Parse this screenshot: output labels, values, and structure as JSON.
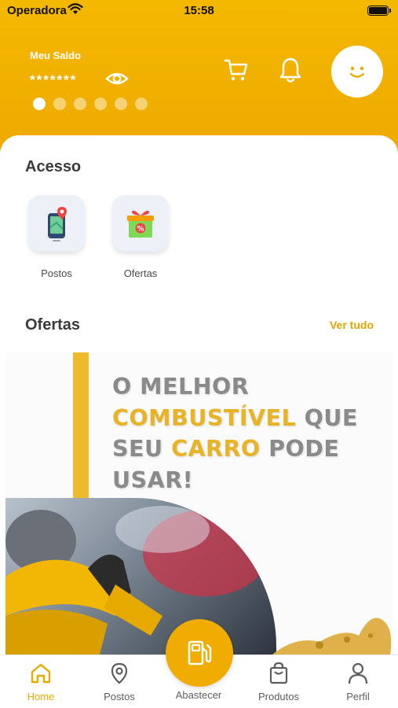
{
  "status_bar": {
    "carrier": "Operadora",
    "time": "15:58"
  },
  "header": {
    "balance_label": "Meu Saldo",
    "balance_value": "*******",
    "carousel": {
      "total": 6,
      "active_index": 0
    }
  },
  "acesso": {
    "title": "Acesso",
    "items": [
      {
        "label": "Postos",
        "icon": "map-pin-phone-icon"
      },
      {
        "label": "Ofertas",
        "icon": "gift-box-icon"
      }
    ]
  },
  "ofertas": {
    "title": "Ofertas",
    "see_all": "Ver tudo",
    "banner": {
      "line1": "O MELHOR",
      "line2_highlight": "COMBUSTÍVEL",
      "line2_rest": " QUE",
      "line3_start": "SEU ",
      "line3_highlight": "CARRO",
      "line3_end": " PODE",
      "line4": "USAR!"
    }
  },
  "tabbar": {
    "items": [
      {
        "label": "Home",
        "icon": "home-icon",
        "active": true
      },
      {
        "label": "Postos",
        "icon": "location-pin-icon",
        "active": false
      },
      {
        "label": "Abastecer",
        "icon": "fuel-pump-icon",
        "active": false
      },
      {
        "label": "Produtos",
        "icon": "shopping-bag-icon",
        "active": false
      },
      {
        "label": "Perfil",
        "icon": "user-icon",
        "active": false
      }
    ]
  },
  "colors": {
    "brand": "#f0ac00",
    "accent_text": "#e0a400",
    "background": "#ffffff"
  }
}
